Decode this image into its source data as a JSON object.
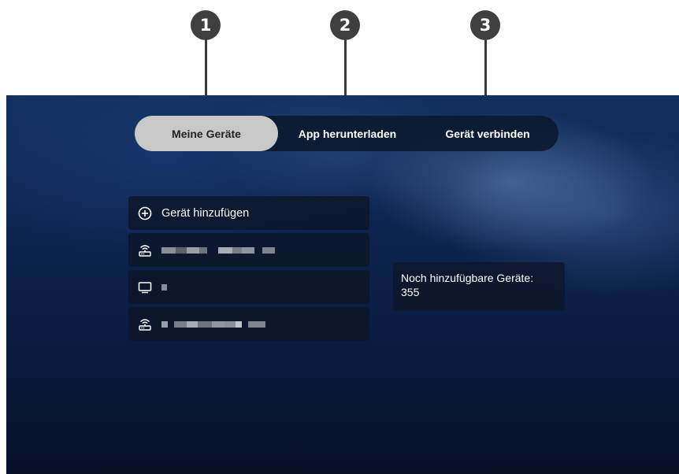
{
  "callouts": [
    "1",
    "2",
    "3"
  ],
  "tabs": [
    {
      "label": "Meine Geräte",
      "active": true
    },
    {
      "label": "App herunterladen",
      "active": false
    },
    {
      "label": "Gerät verbinden",
      "active": false
    }
  ],
  "device_list": {
    "add_label": "Gerät hinzufügen",
    "items": [
      {
        "icon": "router-icon",
        "name_redacted": true
      },
      {
        "icon": "tv-icon",
        "name_redacted": true
      },
      {
        "icon": "router-icon",
        "name_redacted": true
      }
    ]
  },
  "info": {
    "line1": "Noch hinzufügbare Geräte:",
    "count": "355"
  },
  "colors": {
    "active_tab_bg": "#c8c8c8",
    "panel_bg": "#0c1628",
    "callout_bg": "#3f3f3f"
  }
}
